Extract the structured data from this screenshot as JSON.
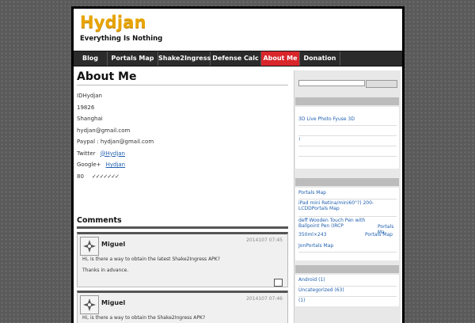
{
  "site": {
    "title": "Hydjan",
    "tagline": "Everything Is Nothing"
  },
  "nav": {
    "items": [
      {
        "label": "Blog"
      },
      {
        "label": "Portals Map"
      },
      {
        "label": "Shake2Ingress"
      },
      {
        "label": "Defense Calc"
      },
      {
        "label": "About Me",
        "active": true
      },
      {
        "label": "Donation"
      }
    ]
  },
  "page": {
    "title": "About Me",
    "lines": {
      "id": "IDHydjan",
      "num": "19826",
      "city": "Shanghai",
      "email": "hydjan@gmail.com",
      "paypal": "Paypal : hydjan@gmail.com",
      "twitter_label": "Twitter",
      "twitter_link": "@Hydjan",
      "google_label": "Google+",
      "google_link": "Hydjan",
      "score": "80",
      "checks": "✓✓✓✓✓✓✓"
    }
  },
  "comments": {
    "title": "Comments",
    "items": [
      {
        "author": "Miguel",
        "date": "2014107 07:45",
        "line1": "Hi, is there a way to obtain the latest Shake2Ingress APK?",
        "line2": "Thanks in advance."
      },
      {
        "author": "Miguel",
        "date": "2014107 07:46",
        "line1": "Hi, is there a way to obtain the Shake2Ingress APK?"
      }
    ]
  },
  "sidebar": {
    "recent": [
      {
        "text": "3D  Live Photo Fyuse  3D"
      },
      {
        "text": ""
      },
      {
        "text": "!"
      },
      {
        "text": ""
      }
    ],
    "posts": [
      {
        "text": "Portals Map"
      },
      {
        "text": "iPad mini Retina/mini60°?) 200-LCDDPortals Map"
      },
      {
        "text": "deff  Wooden Touch Pen with Ballpoint Pen (IRCP"
      },
      {
        "text": "Portals Ma"
      },
      {
        "text": "350ml×243"
      },
      {
        "text": "Portals Map"
      },
      {
        "text": "JonPortals Map"
      }
    ],
    "categories": [
      {
        "text": "Android (1)"
      },
      {
        "text": "Uncategorized (63)"
      },
      {
        "text": " (1)"
      }
    ]
  },
  "colors": {
    "title_orange": "#e8a400",
    "nav_active": "#d9262b",
    "link_blue": "#1f5fae"
  }
}
